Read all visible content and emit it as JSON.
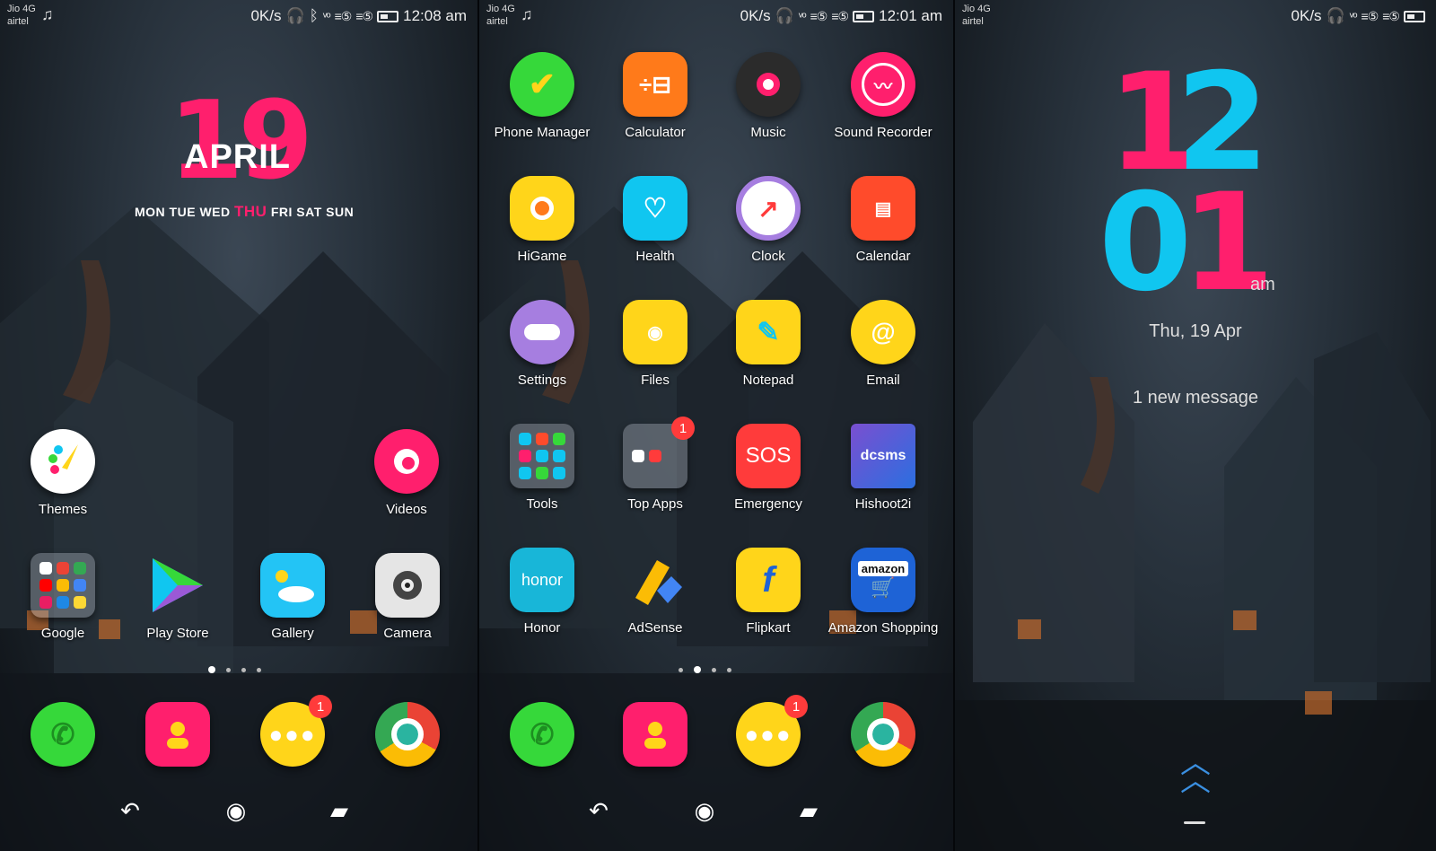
{
  "colors": {
    "pink": "#ff1f6d",
    "cyan": "#10c6f0",
    "yellow": "#ffd51a",
    "green": "#36d83a"
  },
  "status_left": {
    "carrier1": "Jio 4G",
    "carrier2": "airtel",
    "speed": "0K/s",
    "time": "12:08 am"
  },
  "status_mid": {
    "carrier1": "Jio 4G",
    "carrier2": "airtel",
    "speed": "0K/s",
    "time": "12:01 am"
  },
  "status_right": {
    "carrier1": "Jio 4G",
    "carrier2": "airtel",
    "speed": "0K/s"
  },
  "widget": {
    "day": "19",
    "month": "APRIL",
    "weekdays_before": "MON TUE WED",
    "today": "THU",
    "weekdays_after": "FRI SAT SUN"
  },
  "home": {
    "row1": [
      {
        "label": "Themes",
        "icon": "palette-icon"
      },
      {
        "label": "Videos",
        "icon": "video-icon"
      }
    ],
    "row2": [
      {
        "label": "Google",
        "icon": "google-folder-icon"
      },
      {
        "label": "Play Store",
        "icon": "play-store-icon"
      },
      {
        "label": "Gallery",
        "icon": "gallery-icon"
      },
      {
        "label": "Camera",
        "icon": "camera-icon"
      }
    ]
  },
  "drawer": {
    "rows": [
      [
        {
          "label": "Phone Manager"
        },
        {
          "label": "Calculator"
        },
        {
          "label": "Music"
        },
        {
          "label": "Sound Recorder"
        }
      ],
      [
        {
          "label": "HiGame"
        },
        {
          "label": "Health"
        },
        {
          "label": "Clock"
        },
        {
          "label": "Calendar"
        }
      ],
      [
        {
          "label": "Settings"
        },
        {
          "label": "Files"
        },
        {
          "label": "Notepad"
        },
        {
          "label": "Email"
        }
      ],
      [
        {
          "label": "Tools"
        },
        {
          "label": "Top Apps",
          "badge": "1"
        },
        {
          "label": "Emergency",
          "glyph": "SOS"
        },
        {
          "label": "Hishoot2i",
          "glyph": "dcsms"
        }
      ],
      [
        {
          "label": "Honor",
          "glyph": "honor"
        },
        {
          "label": "AdSense"
        },
        {
          "label": "Flipkart"
        },
        {
          "label": "Amazon Shopping",
          "glyph": "amazon"
        }
      ]
    ]
  },
  "dock": {
    "messages_badge": "1"
  },
  "lock": {
    "hour": "12",
    "minute": "01",
    "ampm": "am",
    "date": "Thu, 19 Apr",
    "notice": "1 new message"
  }
}
